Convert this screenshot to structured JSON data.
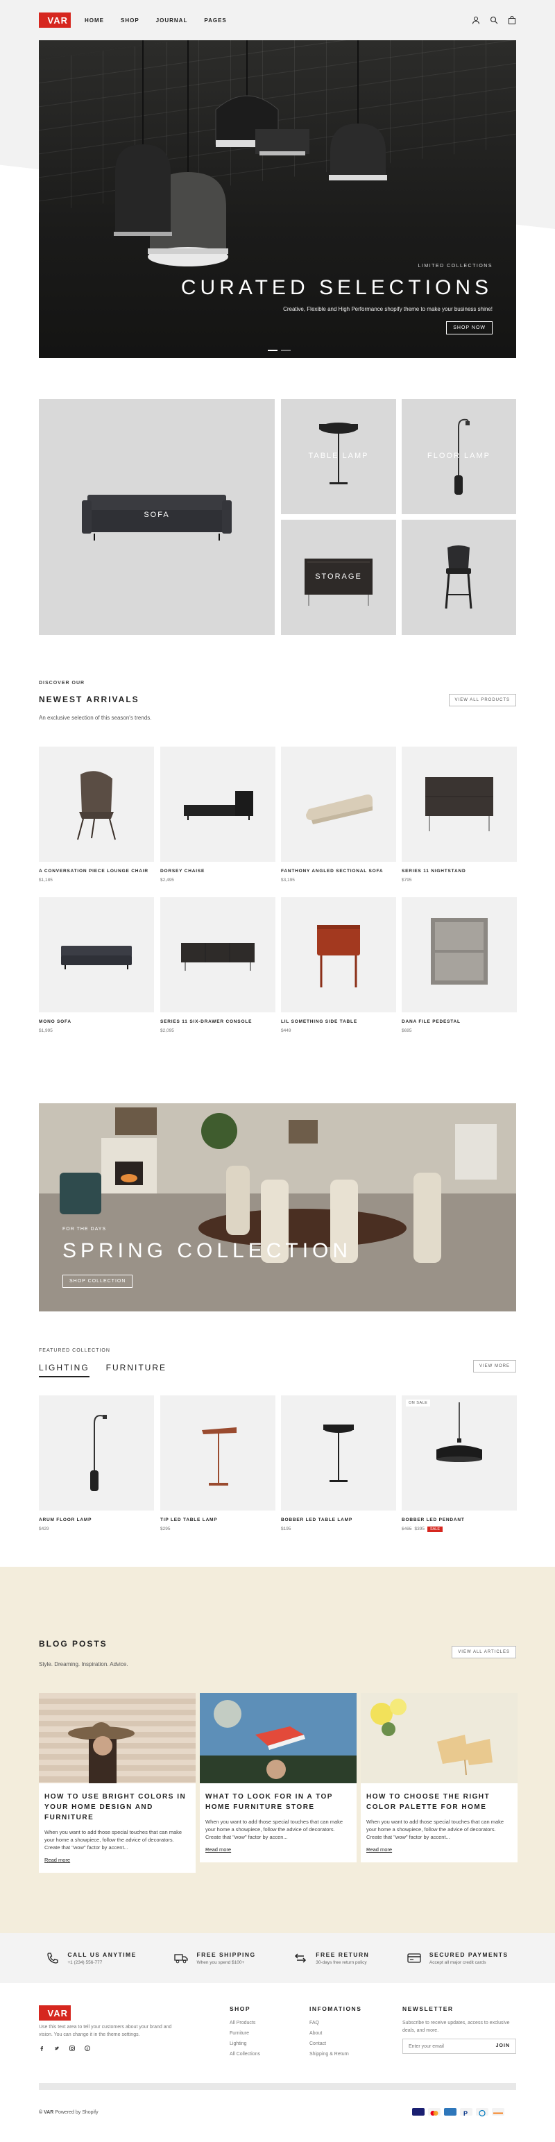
{
  "brand": {
    "logo": "VAR",
    "accent": "#d6271f"
  },
  "nav": {
    "items": [
      "HOME",
      "SHOP",
      "JOURNAL",
      "PAGES"
    ]
  },
  "header_icons": [
    "account-icon",
    "search-icon",
    "cart-icon"
  ],
  "hero": {
    "kicker": "LIMITED COLLECTIONS",
    "title": "CURATED SELECTIONS",
    "description": "Creative, Flexible and High Performance shopify theme to make your business shine!",
    "button": "SHOP NOW"
  },
  "categories": [
    {
      "label": "SOFA"
    },
    {
      "label": "TABLE LAMP"
    },
    {
      "label": "FLOOR LAMP"
    },
    {
      "label": "STORAGE"
    },
    {
      "label": ""
    }
  ],
  "newest": {
    "kicker": "DISCOVER OUR",
    "title": "NEWEST ARRIVALS",
    "description": "An exclusive selection of this season's trends.",
    "button": "VIEW ALL PRODUCTS",
    "products": [
      {
        "name": "A CONVERSATION PIECE LOUNGE CHAIR",
        "price": "$1,185"
      },
      {
        "name": "DORSEY CHAISE",
        "price": "$2,495"
      },
      {
        "name": "FANTHONY ANGLED SECTIONAL SOFA",
        "price": "$3,195"
      },
      {
        "name": "SERIES 11 NIGHTSTAND",
        "price": "$795"
      },
      {
        "name": "MONO SOFA",
        "price": "$1,995"
      },
      {
        "name": "SERIES 11 SIX-DRAWER CONSOLE",
        "price": "$2,095"
      },
      {
        "name": "LIL SOMETHING SIDE TABLE",
        "price": "$449"
      },
      {
        "name": "DANA FILE PEDESTAL",
        "price": "$695"
      }
    ]
  },
  "spring": {
    "kicker": "FOR THE DAYS",
    "title": "SPRING COLLECTION",
    "button": "SHOP COLLECTION"
  },
  "featured": {
    "kicker": "FEATURED COLLECTION",
    "tabs": [
      "LIGHTING",
      "FURNITURE"
    ],
    "button": "VIEW MORE",
    "products": [
      {
        "name": "ARUM FLOOR LAMP",
        "price": "$429"
      },
      {
        "name": "TIP LED TABLE LAMP",
        "price": "$295"
      },
      {
        "name": "BOBBER LED TABLE LAMP",
        "price": "$195"
      },
      {
        "name": "BOBBER LED PENDANT",
        "badge": "ON SALE",
        "old_price": "$495",
        "price": "$395",
        "sale_tag": "SALE"
      }
    ]
  },
  "blog": {
    "title": "BLOG POSTS",
    "description": "Style. Dreaming. Inspiration. Advice.",
    "button": "VIEW ALL ARTICLES",
    "posts": [
      {
        "title": "HOW TO USE BRIGHT COLORS IN YOUR HOME DESIGN AND FURNITURE",
        "excerpt": "When you want to add those special touches that can make your home a showpiece, follow the advice of decorators. Create that \"wow\" factor by accent...",
        "more": "Read more"
      },
      {
        "title": "WHAT TO LOOK FOR IN A TOP HOME FURNITURE STORE",
        "excerpt": "When you want to add those special touches that can make your home a showpiece, follow the advice of decorators. Create that \"wow\" factor by accen...",
        "more": "Read more"
      },
      {
        "title": "HOW TO CHOOSE THE RIGHT COLOR PALETTE FOR HOME",
        "excerpt": "When you want to add those special touches that can make your home a showpiece, follow the advice of decorators. Create that \"wow\" factor by accent...",
        "more": "Read more"
      }
    ]
  },
  "features": [
    {
      "icon": "phone-icon",
      "title": "CALL US ANYTIME",
      "sub": "+1 (234) 556-777"
    },
    {
      "icon": "truck-icon",
      "title": "FREE SHIPPING",
      "sub": "When you spend $100+"
    },
    {
      "icon": "return-icon",
      "title": "FREE RETURN",
      "sub": "30-days free return policy"
    },
    {
      "icon": "card-icon",
      "title": "SECURED PAYMENTS",
      "sub": "Accept all major credit cards"
    }
  ],
  "footer": {
    "about": "Use this text area to tell your customers about your brand and vision. You can change it in the theme settings.",
    "shop": {
      "title": "SHOP",
      "links": [
        "All Products",
        "Furniture",
        "Lighting",
        "All Collections"
      ]
    },
    "info": {
      "title": "INFOMATIONS",
      "links": [
        "FAQ",
        "About",
        "Contact",
        "Shipping & Return"
      ]
    },
    "newsletter": {
      "title": "NEWSLETTER",
      "text": "Subscribe to receive updates, access to exclusive deals, and more.",
      "placeholder": "Enter your email",
      "button": "JOIN"
    },
    "copyright_brand": "© VAR",
    "copyright_rest": " Powered by Shopify",
    "social": [
      "facebook-icon",
      "twitter-icon",
      "instagram-icon",
      "pinterest-icon"
    ],
    "payments": [
      "visa-icon",
      "mastercard-icon",
      "amex-icon",
      "paypal-icon",
      "diners-icon",
      "discover-icon"
    ]
  }
}
